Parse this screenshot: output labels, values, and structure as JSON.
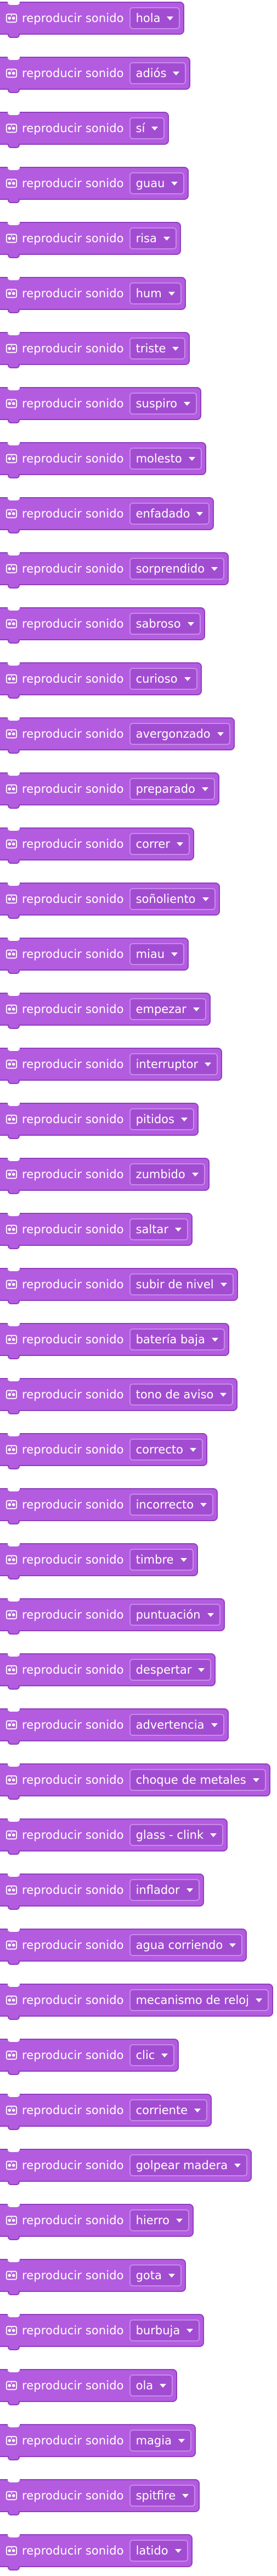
{
  "block_label": "reproducir sonido",
  "block_icon": "speaker-icon",
  "dropdown_icon": "chevron-down-icon",
  "colors": {
    "block_fill": "#b35ce0",
    "block_border": "#8f3fbf",
    "dropdown_fill": "#a24dd1",
    "dropdown_border": "#c98aeb",
    "text": "#ffffff",
    "background": "#ffffff"
  },
  "blocks": [
    {
      "sound": "hola"
    },
    {
      "sound": "adiós"
    },
    {
      "sound": "sí"
    },
    {
      "sound": "guau"
    },
    {
      "sound": "risa"
    },
    {
      "sound": "hum"
    },
    {
      "sound": "triste"
    },
    {
      "sound": "suspiro"
    },
    {
      "sound": "molesto"
    },
    {
      "sound": "enfadado"
    },
    {
      "sound": "sorprendido"
    },
    {
      "sound": "sabroso"
    },
    {
      "sound": "curioso"
    },
    {
      "sound": "avergonzado"
    },
    {
      "sound": "preparado"
    },
    {
      "sound": "correr"
    },
    {
      "sound": "soñoliento"
    },
    {
      "sound": "miau"
    },
    {
      "sound": "empezar"
    },
    {
      "sound": "interruptor"
    },
    {
      "sound": "pitidos"
    },
    {
      "sound": "zumbido"
    },
    {
      "sound": "saltar"
    },
    {
      "sound": "subir de nivel"
    },
    {
      "sound": "batería baja"
    },
    {
      "sound": "tono de aviso"
    },
    {
      "sound": "correcto"
    },
    {
      "sound": "incorrecto"
    },
    {
      "sound": "timbre"
    },
    {
      "sound": "puntuación"
    },
    {
      "sound": "despertar"
    },
    {
      "sound": "advertencia"
    },
    {
      "sound": "choque de metales"
    },
    {
      "sound": "glass - clink"
    },
    {
      "sound": "inflador"
    },
    {
      "sound": "agua corriendo"
    },
    {
      "sound": "mecanismo de reloj"
    },
    {
      "sound": "clic"
    },
    {
      "sound": "corriente"
    },
    {
      "sound": "golpear madera"
    },
    {
      "sound": "hierro"
    },
    {
      "sound": "gota"
    },
    {
      "sound": "burbuja"
    },
    {
      "sound": "ola"
    },
    {
      "sound": "magia"
    },
    {
      "sound": "spitfire"
    },
    {
      "sound": "latido"
    }
  ]
}
